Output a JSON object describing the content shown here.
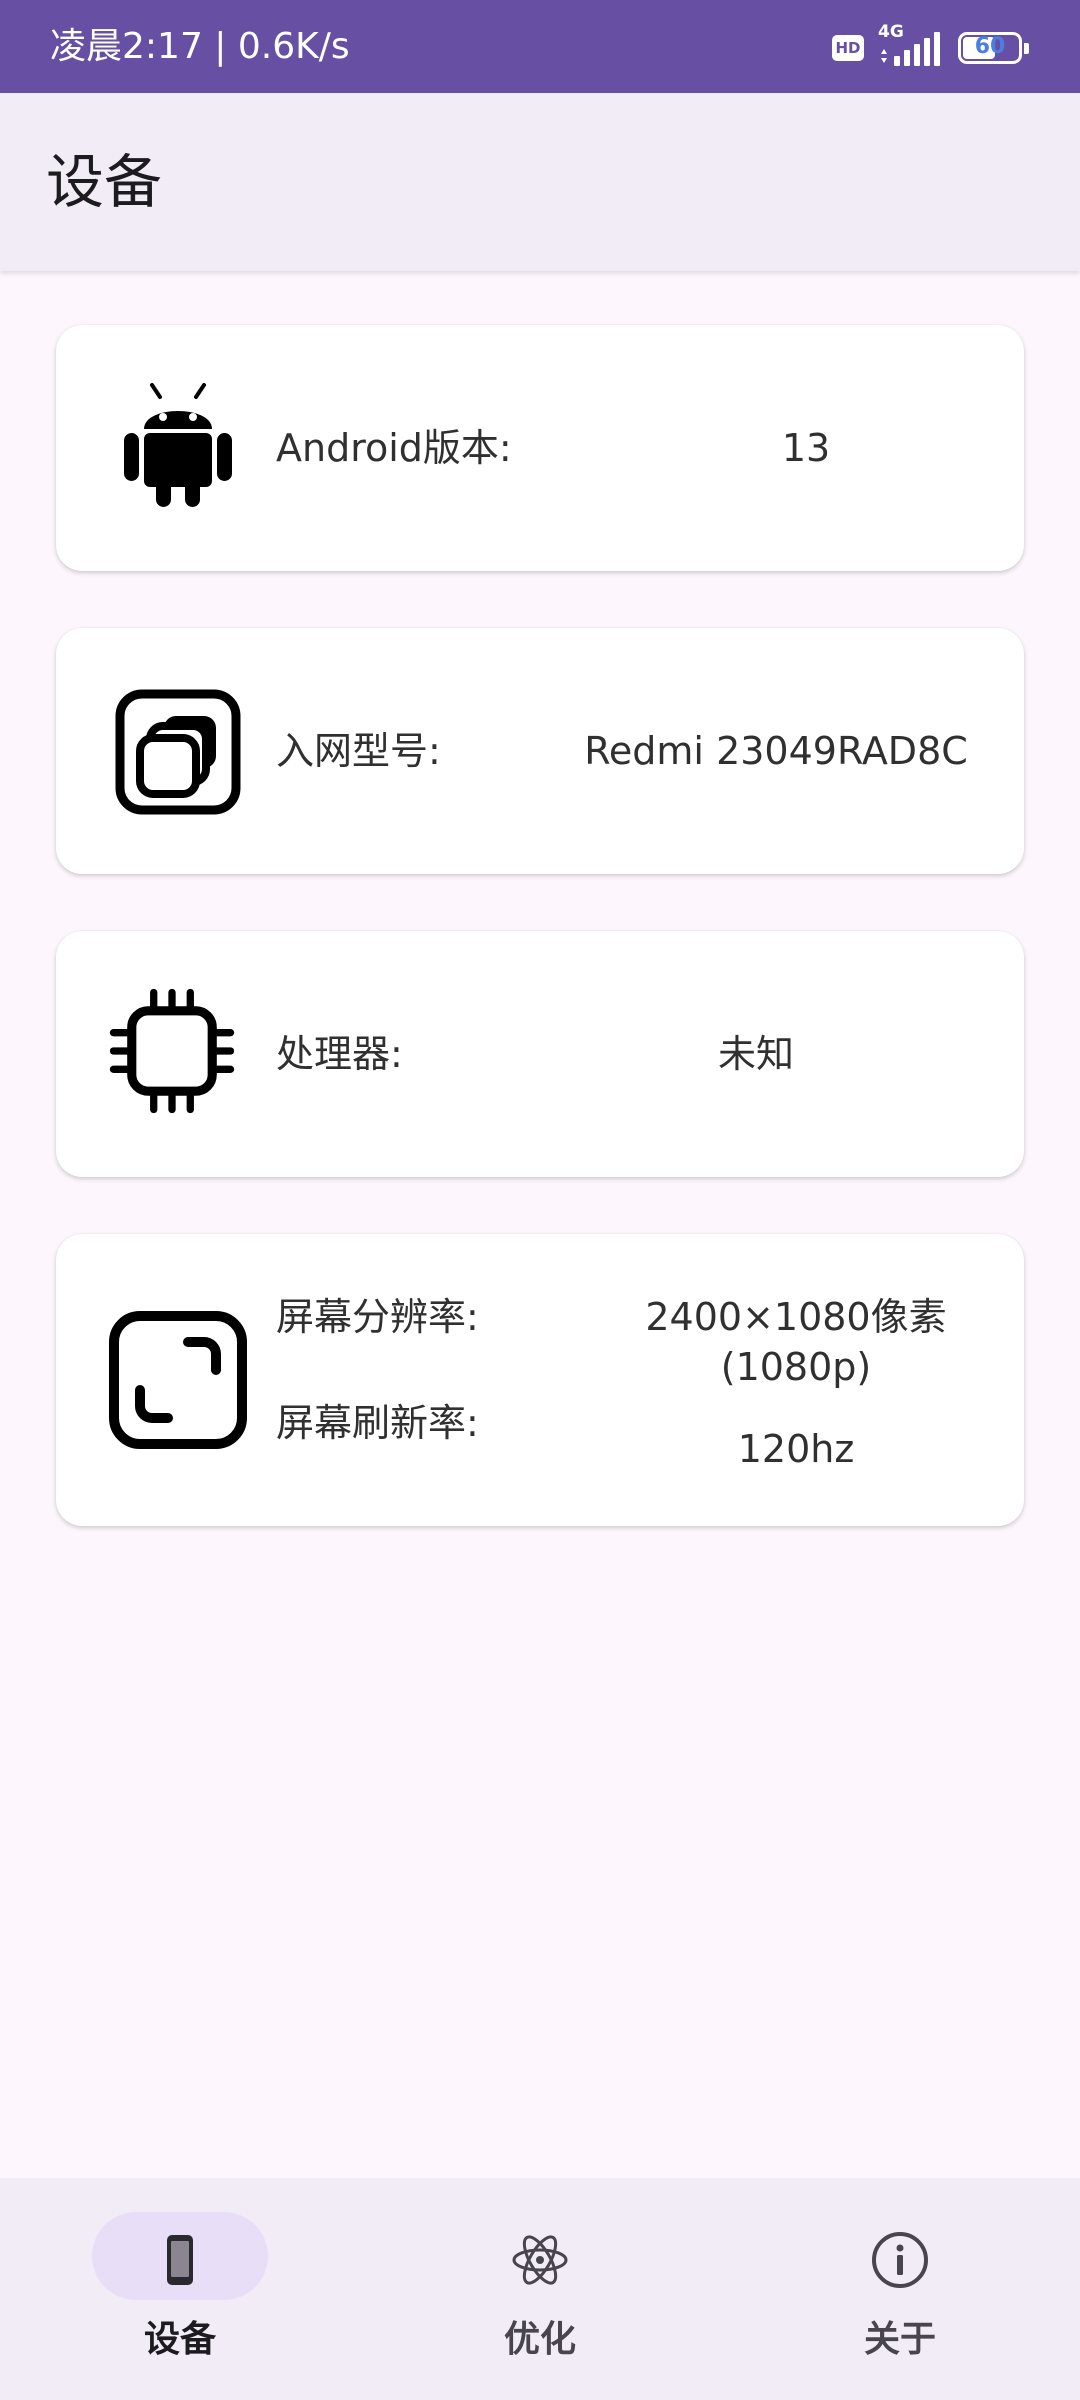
{
  "status_bar": {
    "time_and_speed": "凌晨2:17 | 0.6K/s",
    "hd_badge": "HD",
    "network_type": "4G",
    "battery_level": "60",
    "battery_fraction": 0.6,
    "signal_bars": 5,
    "icons": [
      "hd-icon",
      "signal-icon",
      "battery-icon"
    ]
  },
  "app_bar": {
    "title": "设备"
  },
  "cards": {
    "android": {
      "icon": "android-icon",
      "label": "Android版本:",
      "value": "13"
    },
    "model": {
      "icon": "device-layers-icon",
      "label": "入网型号:",
      "value": "Redmi 23049RAD8C"
    },
    "cpu": {
      "icon": "chip-icon",
      "label": "处理器:",
      "value": "未知"
    },
    "screen": {
      "icon": "screen-resize-icon",
      "resolution_label": "屏幕分辨率:",
      "resolution_value_line1": "2400×1080像素",
      "resolution_value_line2": "(1080p)",
      "refresh_label": "屏幕刷新率:",
      "refresh_value": "120hz"
    }
  },
  "bottom_nav": {
    "items": [
      {
        "label": "设备",
        "icon": "phone-icon",
        "active": true
      },
      {
        "label": "优化",
        "icon": "atom-icon",
        "active": false
      },
      {
        "label": "关于",
        "icon": "info-icon",
        "active": false
      }
    ]
  },
  "colors": {
    "status_bar": "#6750a4",
    "app_bar": "#f2ecf6",
    "background": "#fdf7fd",
    "card": "#ffffff",
    "nav_active_pill": "#e8def8",
    "battery_text": "#4a7fe0"
  }
}
